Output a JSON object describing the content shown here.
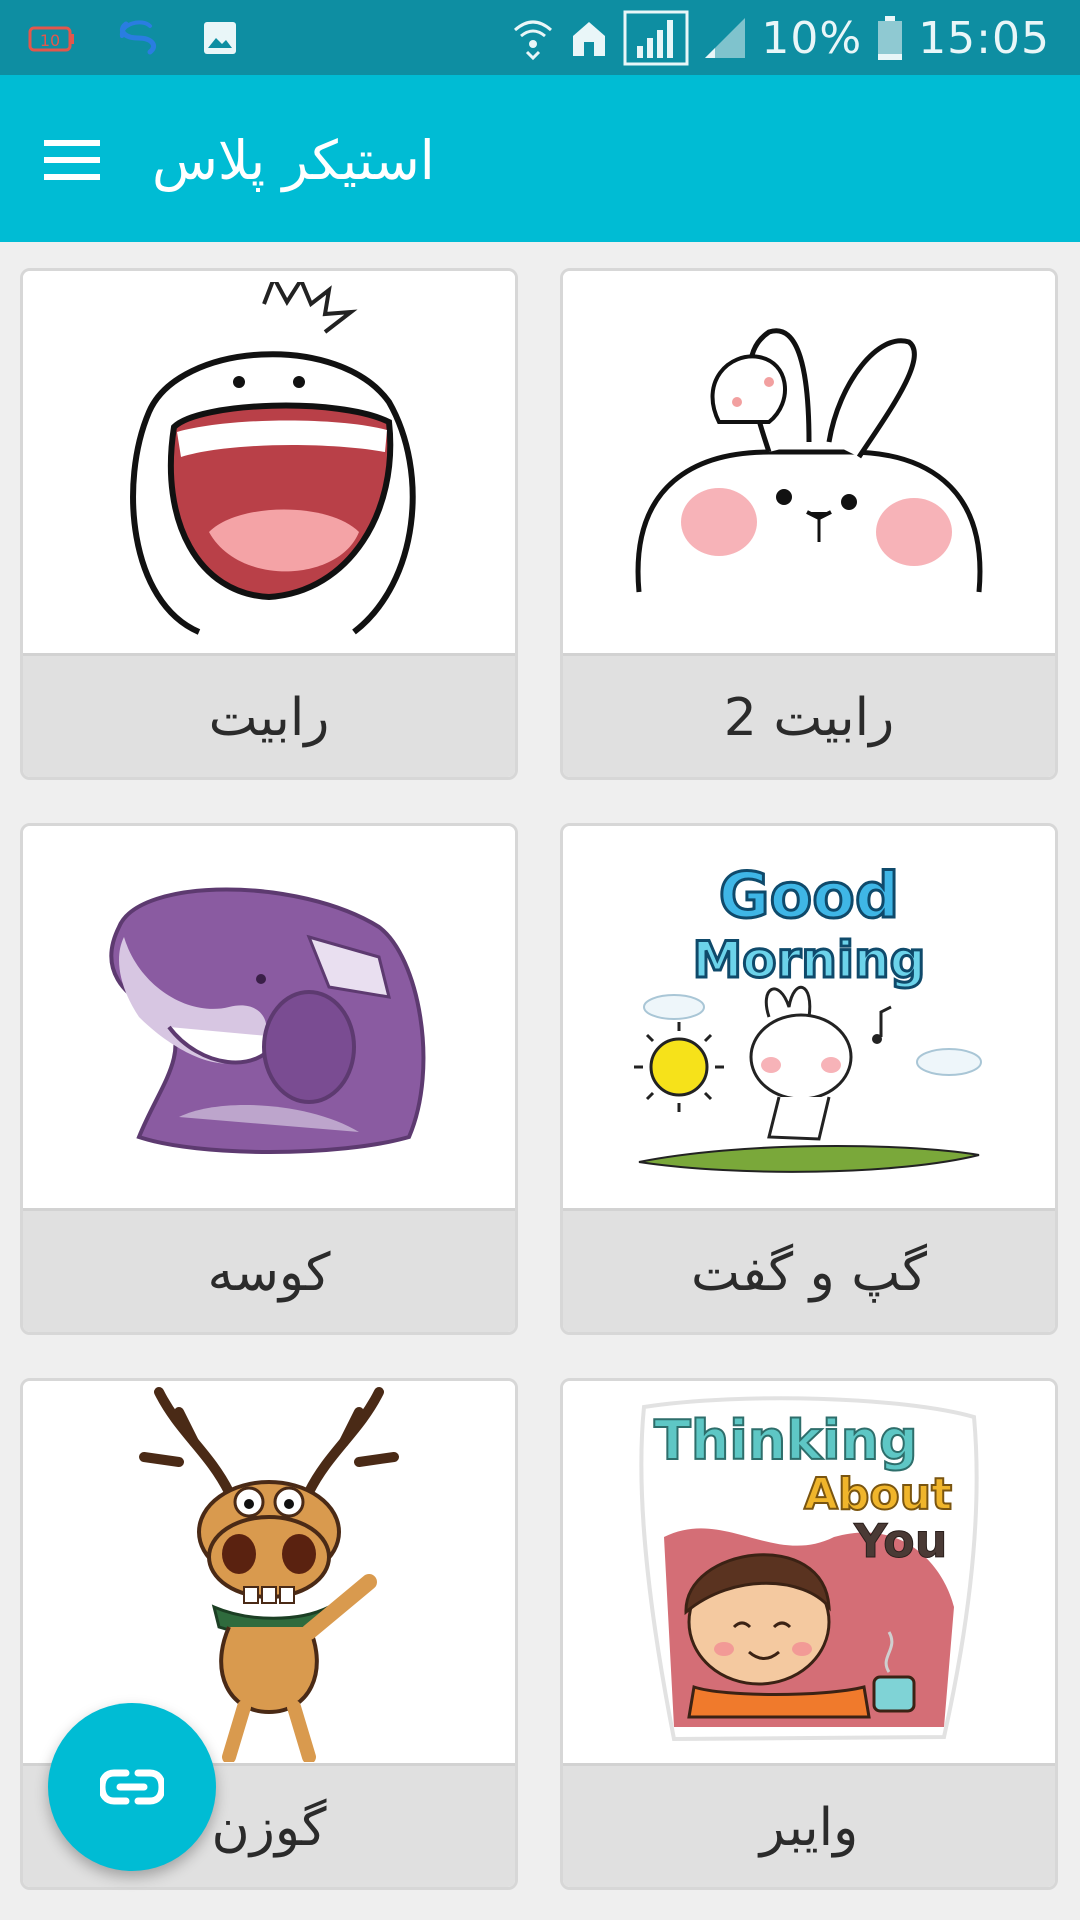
{
  "status_bar": {
    "left_icons": [
      "battery-alert-icon",
      "s-app-icon",
      "image-notification-icon"
    ],
    "right_icons": [
      "wifi-icon",
      "home-icon",
      "signal-full-icon",
      "signal-weak-icon",
      "battery-icon"
    ],
    "battery": "10%",
    "time": "15:05",
    "battery_badge": "10"
  },
  "app_bar": {
    "title": "استیکر پلاس",
    "menu_icon": "hamburger-menu-icon",
    "color": "#00bcd4"
  },
  "packs": [
    {
      "label": "رابیت",
      "icon": "laughing-face-sticker"
    },
    {
      "label": "رابیت 2",
      "icon": "bunny-sticker"
    },
    {
      "label": "کوسه",
      "icon": "shark-sticker"
    },
    {
      "label": "گپ و گفت",
      "icon": "good-morning-sticker",
      "sticker_text": [
        "Good",
        "Morning"
      ]
    },
    {
      "label": "گوزن",
      "icon": "reindeer-sticker"
    },
    {
      "label": "وایبر",
      "icon": "thinking-about-you-sticker",
      "sticker_text": [
        "Thinking",
        "About",
        "You"
      ]
    }
  ],
  "fab": {
    "icon": "link-icon"
  },
  "colors": {
    "status_bar": "#0e8ea2",
    "accent": "#00bcd4",
    "label_bg": "#e0e0e0"
  }
}
